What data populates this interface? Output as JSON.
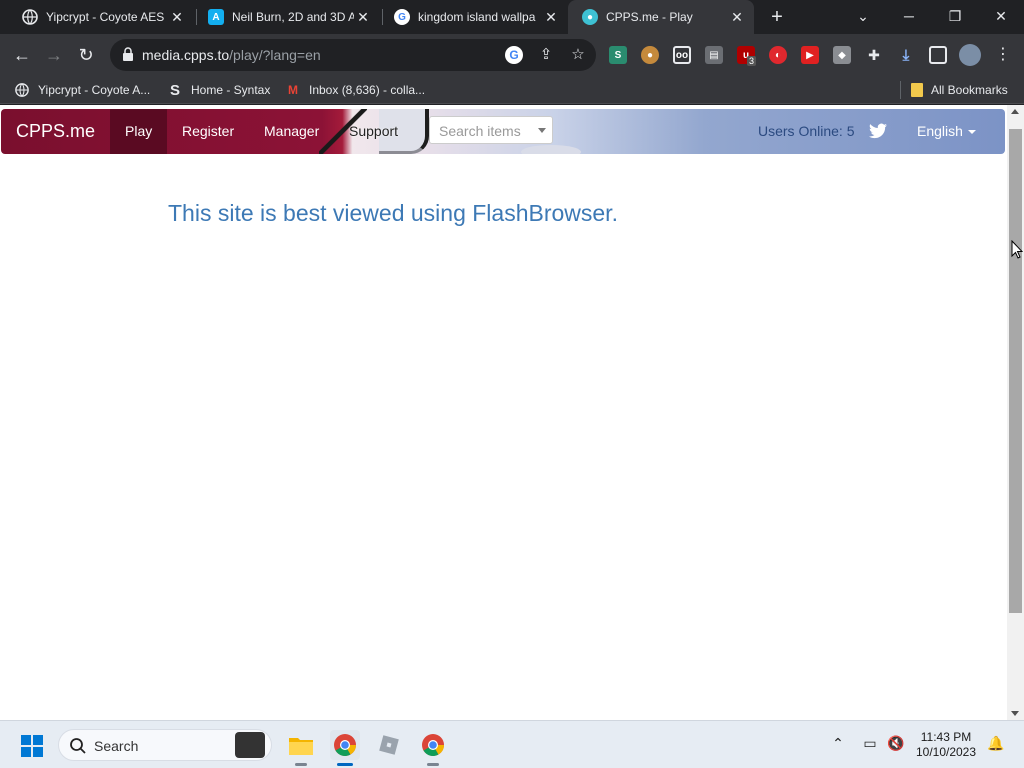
{
  "browser": {
    "tabs": [
      {
        "title": "Yipcrypt - Coyote AES",
        "icon": "globe-icon",
        "active": false
      },
      {
        "title": "Neil Burn, 2D and 3D A",
        "icon": "artstation-icon",
        "active": false
      },
      {
        "title": "kingdom island wallpa",
        "icon": "google-icon",
        "active": false
      },
      {
        "title": "CPPS.me - Play",
        "icon": "cpps-icon",
        "active": true
      }
    ],
    "new_tab": "+",
    "url_host": "media.cpps.to",
    "url_path": "/play/?lang=en",
    "extension_badge": "3",
    "bookmarks": [
      {
        "label": "Yipcrypt - Coyote A...",
        "icon": "globe-icon"
      },
      {
        "label": "Home - Syntax",
        "icon": "syntax-s-icon"
      },
      {
        "label": "Inbox (8,636) - colla...",
        "icon": "gmail-icon"
      }
    ],
    "all_bookmarks": "All Bookmarks"
  },
  "site": {
    "brand": "CPPS.me",
    "nav": [
      {
        "label": "Play",
        "active": true
      },
      {
        "label": "Register",
        "active": false
      },
      {
        "label": "Manager",
        "active": false
      },
      {
        "label": "Support",
        "active": false
      }
    ],
    "search_placeholder": "Search items",
    "users_online": "Users Online: 5",
    "language": "English",
    "notice": "This site is best viewed using FlashBrowser."
  },
  "taskbar": {
    "search_label": "Search",
    "time": "11:43 PM",
    "date": "10/10/2023"
  },
  "colors": {
    "nav_dark": "#7a0f2e",
    "link_blue": "#3d79b5",
    "browser_bg": "#202124"
  }
}
